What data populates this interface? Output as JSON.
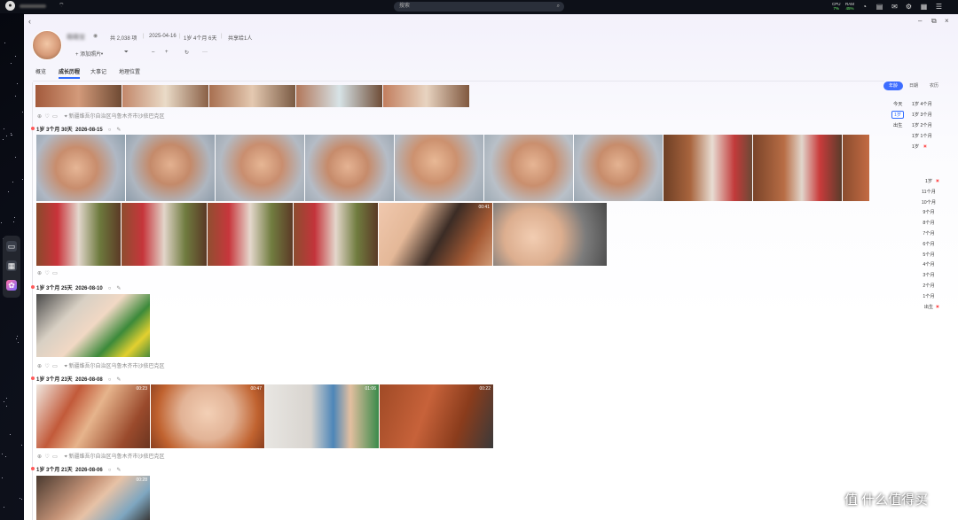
{
  "topbar": {
    "search_placeholder": "搜索",
    "cpu_label": "CPU",
    "cpu_value": "7%",
    "ram_label": "RAM",
    "ram_value": "45%"
  },
  "window": {
    "back": "‹",
    "min": "–",
    "restore": "⧉",
    "close": "×"
  },
  "profile": {
    "name": "萌萌宝",
    "photo_count": "共 2,038 项",
    "birth_date": "2025-04-16",
    "age": "1岁 4个月 6天",
    "shared": "共享给1人"
  },
  "toolbar": {
    "add_photo": "+ 添加照片",
    "filter": "⏷",
    "zoom_out": "–",
    "zoom_in": "+",
    "refresh": "↻",
    "more": "···"
  },
  "tabs": [
    "概览",
    "成长历程",
    "大事记",
    "地理位置"
  ],
  "location": "新疆维吾尔自治区乌鲁木齐市沙依巴克区",
  "groups": [
    {
      "age": "1岁 3个月 30天",
      "date": "2026-08-15"
    },
    {
      "age": "1岁 3个月 25天",
      "date": "2026-08-10"
    },
    {
      "age": "1岁 3个月 23天",
      "date": "2026-08-08"
    },
    {
      "age": "1岁 3个月 21天",
      "date": "2026-08-06"
    }
  ],
  "durations": [
    "00:41",
    "00:23",
    "00:47",
    "01:06",
    "00:22",
    "00:28"
  ],
  "sidebar": {
    "segments": [
      "年龄",
      "日期",
      "农历"
    ],
    "top_rows": [
      {
        "left": "今天",
        "right": "1岁 4个月"
      },
      {
        "left": "1岁",
        "right": "1岁 3个月"
      },
      {
        "left": "出生",
        "right": "1岁 2个月"
      },
      {
        "left": "",
        "right": "1岁 1个月"
      },
      {
        "left": "",
        "right": "1岁"
      }
    ],
    "list": [
      "1岁",
      "11个月",
      "10个月",
      "9个月",
      "8个月",
      "7个月",
      "6个月",
      "5个月",
      "4个月",
      "3个月",
      "2个月",
      "1个月",
      "出生"
    ]
  },
  "watermark": "值 什么值得买"
}
